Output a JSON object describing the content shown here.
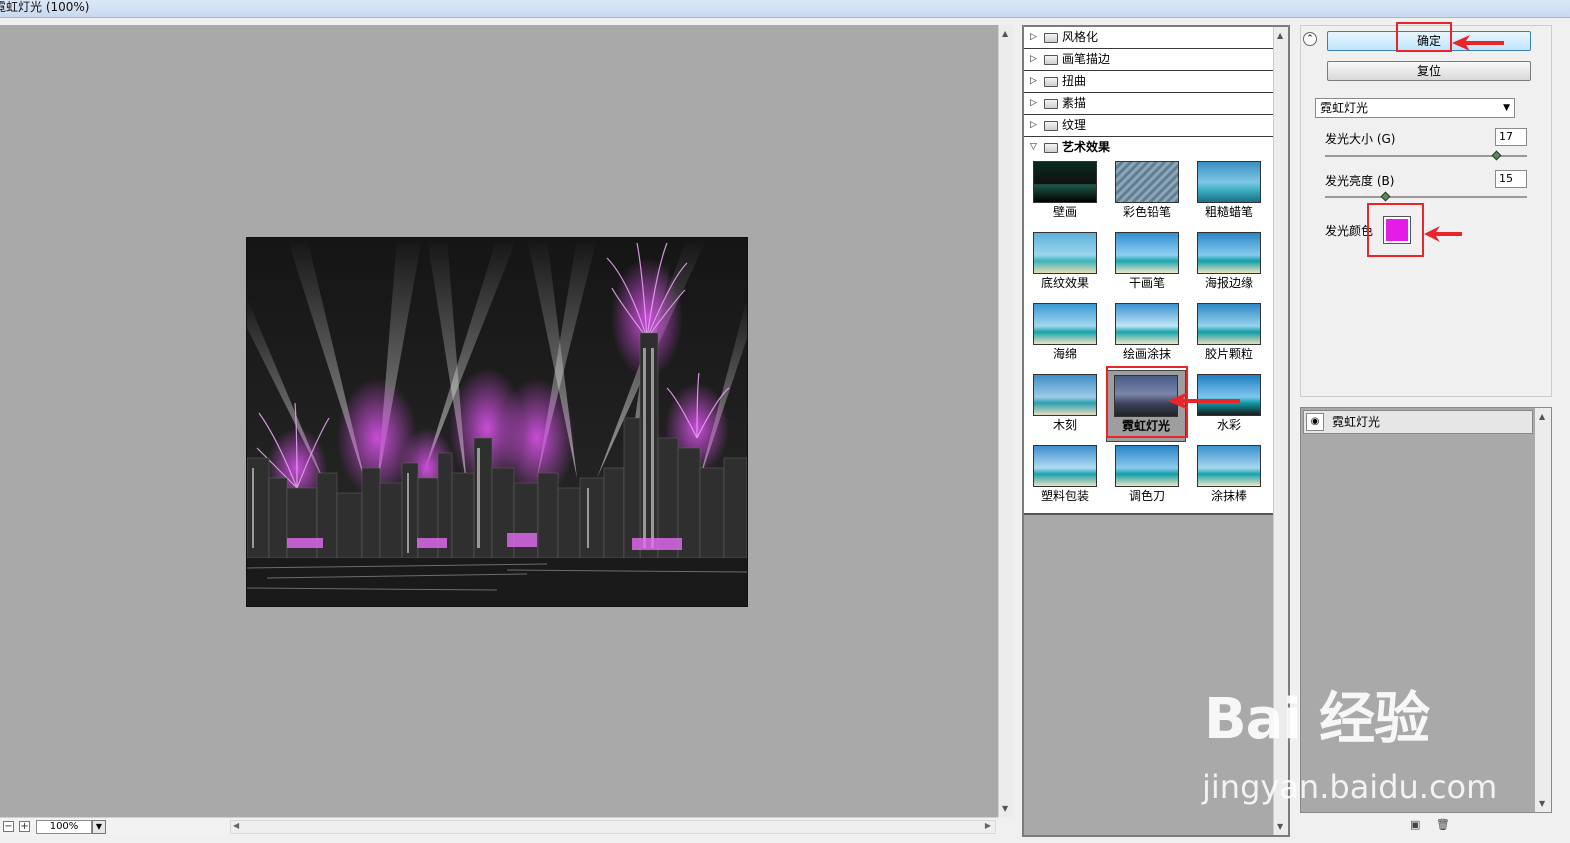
{
  "window": {
    "title": "霓虹灯光 (100%)"
  },
  "preview": {
    "zoom": "100%",
    "minus_label": "−",
    "plus_label": "+"
  },
  "gallery": {
    "categories": [
      {
        "label": "风格化",
        "open": false
      },
      {
        "label": "画笔描边",
        "open": false
      },
      {
        "label": "扭曲",
        "open": false
      },
      {
        "label": "素描",
        "open": false
      },
      {
        "label": "纹理",
        "open": false
      },
      {
        "label": "艺术效果",
        "open": true
      }
    ],
    "filters": [
      {
        "label": "壁画",
        "icon": "mural-thumb"
      },
      {
        "label": "彩色铅笔",
        "icon": "colored-pencil-thumb"
      },
      {
        "label": "粗糙蜡笔",
        "icon": "rough-pastels-thumb"
      },
      {
        "label": "底纹效果",
        "icon": "underpainting-thumb"
      },
      {
        "label": "干画笔",
        "icon": "dry-brush-thumb"
      },
      {
        "label": "海报边缘",
        "icon": "poster-edges-thumb"
      },
      {
        "label": "海绵",
        "icon": "sponge-thumb"
      },
      {
        "label": "绘画涂抹",
        "icon": "paint-daubs-thumb"
      },
      {
        "label": "胶片颗粒",
        "icon": "film-grain-thumb"
      },
      {
        "label": "木刻",
        "icon": "cutout-thumb"
      },
      {
        "label": "霓虹灯光",
        "icon": "neon-glow-thumb",
        "selected": true
      },
      {
        "label": "水彩",
        "icon": "watercolor-thumb"
      },
      {
        "label": "塑料包装",
        "icon": "plastic-wrap-thumb"
      },
      {
        "label": "调色刀",
        "icon": "palette-knife-thumb"
      },
      {
        "label": "涂抹棒",
        "icon": "smudge-stick-thumb"
      }
    ]
  },
  "settings": {
    "ok_label": "确定",
    "reset_label": "复位",
    "selected_filter": "霓虹灯光",
    "glow_size_label": "发光大小 (G)",
    "glow_size_value": "17",
    "glow_size_fraction": 0.85,
    "glow_brightness_label": "发光亮度 (B)",
    "glow_brightness_value": "15",
    "glow_brightness_fraction": 0.3,
    "glow_color_label": "发光颜色",
    "glow_color": "#e41ce8"
  },
  "layers": {
    "items": [
      {
        "label": "霓虹灯光"
      }
    ]
  },
  "watermark": {
    "logo_text": "Bai 经验",
    "url_text": "jingyan.baidu.com"
  },
  "colors": {
    "annotation_red": "#e8262a",
    "preview_gray": "#a9a9a9"
  }
}
